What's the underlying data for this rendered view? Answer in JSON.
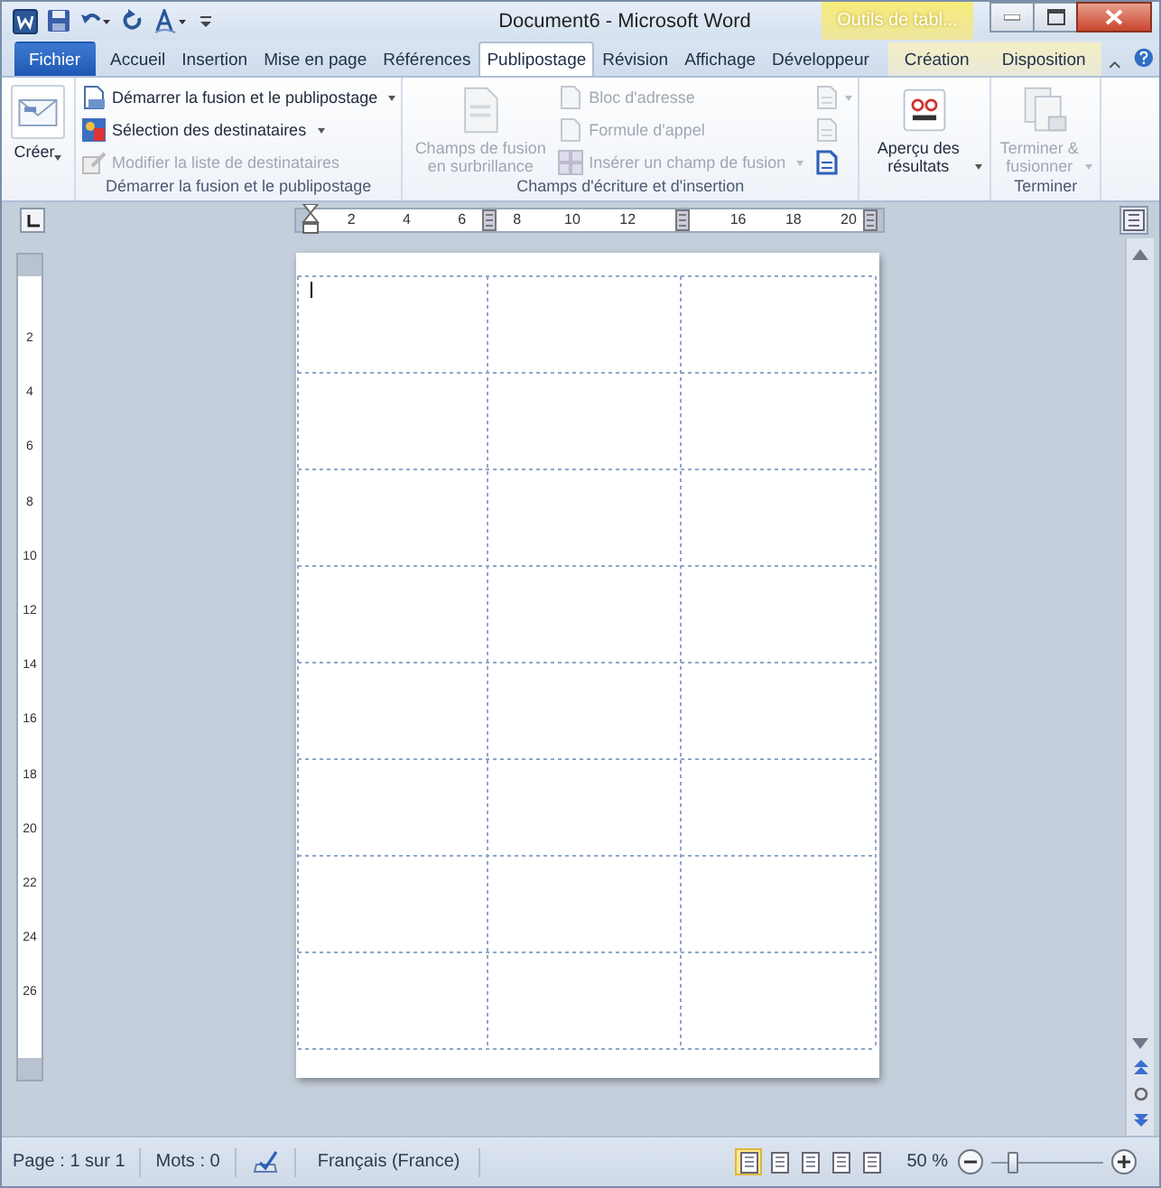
{
  "title_bar": {
    "title": "Document6  -  Microsoft Word",
    "contextual_group": "Outils de tabl..."
  },
  "tabs": [
    {
      "label": "Fichier",
      "kind": "file",
      "selected": false
    },
    {
      "label": "Accueil",
      "kind": "standard",
      "selected": false
    },
    {
      "label": "Insertion",
      "kind": "standard",
      "selected": false
    },
    {
      "label": "Mise en page",
      "kind": "standard",
      "selected": false
    },
    {
      "label": "Références",
      "kind": "standard",
      "selected": false
    },
    {
      "label": "Publipostage",
      "kind": "standard",
      "selected": true
    },
    {
      "label": "Révision",
      "kind": "standard",
      "selected": false
    },
    {
      "label": "Affichage",
      "kind": "standard",
      "selected": false
    },
    {
      "label": "Développeur",
      "kind": "standard",
      "selected": false
    },
    {
      "label": "Création",
      "kind": "contextual",
      "selected": false
    },
    {
      "label": "Disposition",
      "kind": "contextual",
      "selected": false
    }
  ],
  "ribbon": {
    "groups": [
      {
        "columns": [
          {
            "kind": "large",
            "label": "Créer",
            "disabled": false,
            "dropdown": true
          }
        ]
      },
      {
        "caption": "Démarrer la fusion et le publipostage",
        "columns": [
          {
            "kind": "stack",
            "buttons": [
              {
                "label": "Démarrer la fusion et le publipostage",
                "disabled": false,
                "dropdown": true
              },
              {
                "label": "Sélection des destinataires",
                "disabled": false,
                "dropdown": true
              },
              {
                "label": "Modifier la liste de destinataires",
                "disabled": true,
                "dropdown": false
              }
            ]
          }
        ]
      },
      {
        "caption": "Champs d'écriture et d'insertion",
        "columns": [
          {
            "kind": "large",
            "label": "Champs de fusion en surbrillance",
            "disabled": true,
            "dropdown": false
          },
          {
            "kind": "stack",
            "buttons": [
              {
                "label": "Bloc d'adresse",
                "disabled": true,
                "dropdown": false
              },
              {
                "label": "Formule d'appel",
                "disabled": true,
                "dropdown": false
              },
              {
                "label": "Insérer un champ de fusion",
                "disabled": true,
                "dropdown": true
              }
            ]
          },
          {
            "kind": "icons",
            "buttons": [
              {
                "disabled": true,
                "dropdown": true
              },
              {
                "disabled": true,
                "dropdown": false
              },
              {
                "disabled": false,
                "dropdown": false
              }
            ]
          }
        ]
      },
      {
        "columns": [
          {
            "kind": "large",
            "label": "Aperçu des résultats",
            "disabled": false,
            "dropdown": true
          }
        ]
      },
      {
        "caption": "Terminer",
        "columns": [
          {
            "kind": "large",
            "label": "Terminer & fusionner",
            "disabled": true,
            "dropdown": true
          }
        ]
      }
    ]
  },
  "ruler": {
    "horizontal": [
      {
        "kind": "number",
        "label": "2"
      },
      {
        "kind": "number",
        "label": "4"
      },
      {
        "kind": "number",
        "label": "6"
      },
      {
        "kind": "number",
        "label": "8"
      },
      {
        "kind": "number",
        "label": "10"
      },
      {
        "kind": "number",
        "label": "12"
      },
      {
        "kind": "marker"
      },
      {
        "kind": "number",
        "label": "16"
      },
      {
        "kind": "number",
        "label": "18"
      },
      {
        "kind": "number",
        "label": "20"
      }
    ],
    "vertical": [
      "2",
      "4",
      "6",
      "8",
      "10",
      "12",
      "14",
      "16",
      "18",
      "20",
      "22",
      "24",
      "26"
    ]
  },
  "status_bar": {
    "page": "Page : 1 sur 1",
    "words": "Mots : 0",
    "language": "Français (France)",
    "views": [
      {
        "selected": true
      },
      {
        "selected": false
      },
      {
        "selected": false
      },
      {
        "selected": false
      },
      {
        "selected": false
      }
    ],
    "zoom": {
      "reading": "50 %",
      "level": 0.2
    }
  }
}
